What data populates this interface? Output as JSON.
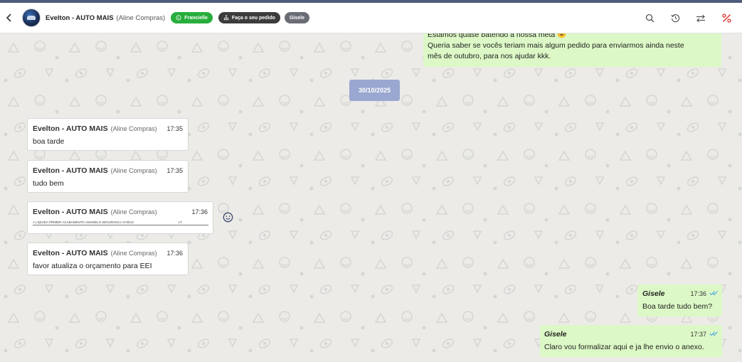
{
  "header": {
    "contact_name": "Evelton - AUTO MAIS",
    "contact_sub": "(Aline Compras)",
    "tags": [
      {
        "label": "Francielle",
        "color": "#27ae3c",
        "icon": "whatsapp-icon"
      },
      {
        "label": "Faça o seu pedido",
        "color": "#3c3c3c",
        "icon": "sitemap-icon"
      },
      {
        "label": "Gisele",
        "color": "#6a6d75"
      }
    ],
    "actions": [
      "search-icon",
      "history-icon",
      "transfer-icon",
      "percent-icon"
    ]
  },
  "chat": {
    "top_message": {
      "lines": [
        "Estamos quase batendo a nossa meta",
        "Queria saber se vocês teriam mais algum pedido para enviarmos ainda neste",
        "mês de outubro, para nos ajudar kkk."
      ],
      "emoji": "grinning-emoji"
    },
    "date_separator": "30/10/2025",
    "incoming": [
      {
        "sender": "Evelton - AUTO MAIS",
        "sub": "(Aline Compras)",
        "time": "17:35",
        "text": "boa tarde"
      },
      {
        "sender": "Evelton - AUTO MAIS",
        "sub": "(Aline Compras)",
        "time": "17:35",
        "text": "tudo bem"
      },
      {
        "sender": "Evelton - AUTO MAIS",
        "sub": "(Aline Compras)",
        "time": "17:36",
        "attachment_left": "A LIQUIDA PRIMER ACABAMENTO AMARELO SEGURANCA SYB/12",
        "attachment_right": "LT"
      },
      {
        "sender": "Evelton - AUTO MAIS",
        "sub": "(Aline Compras)",
        "time": "17:36",
        "text": "favor atualiza o orçamento para EEI"
      }
    ],
    "outgoing": [
      {
        "sender": "Gisele",
        "time": "17:36",
        "text": "Boa tarde tudo bem?"
      },
      {
        "sender": "Gisele",
        "time": "17:37",
        "text": "Claro vou formalizar aqui e ja lhe envio o anexo."
      }
    ]
  },
  "colors": {
    "accent_stripe": "#4f5b7a",
    "outgoing_bubble": "#dcf8c6",
    "date_chip": "#9aa7d0",
    "read_ticks": "#4fa3e0"
  }
}
